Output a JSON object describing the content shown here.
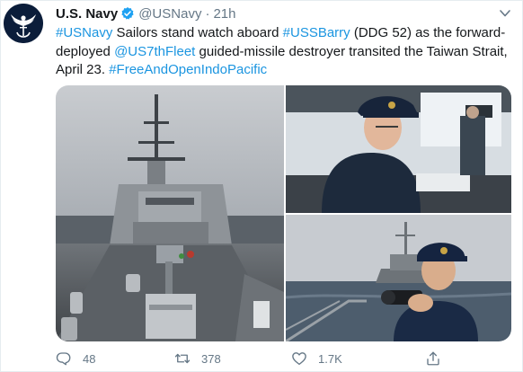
{
  "author": {
    "display_name": "U.S. Navy",
    "handle": "@USNavy",
    "separator": "·",
    "time": "21h",
    "verified": true,
    "avatar_icon": "navy-eagle-anchor-logo",
    "brand_color": "#0b1d3a"
  },
  "tweet": {
    "hashtag_navy": "#USNavy",
    "text_1": " Sailors stand watch aboard ",
    "hashtag_ship": "#USSBarry",
    "text_2": " (DDG 52) as the forward-deployed ",
    "mention_fleet": "@US7thFleet",
    "text_3": " guided-missile destroyer transited the Taiwan Strait, April 23. ",
    "hashtag_indo": "#FreeAndOpenIndoPacific",
    "link_color": "#1b95e0"
  },
  "media": {
    "photo_main": "destroyer-bow-mast-photo",
    "photo_top": "sailor-at-console-photo",
    "photo_bottom": "sailor-binoculars-photo"
  },
  "actions": {
    "reply_count": "48",
    "retweet_count": "378",
    "like_count": "1.7K",
    "reply_icon": "reply-icon",
    "retweet_icon": "retweet-icon",
    "like_icon": "heart-icon",
    "share_icon": "share-icon"
  }
}
